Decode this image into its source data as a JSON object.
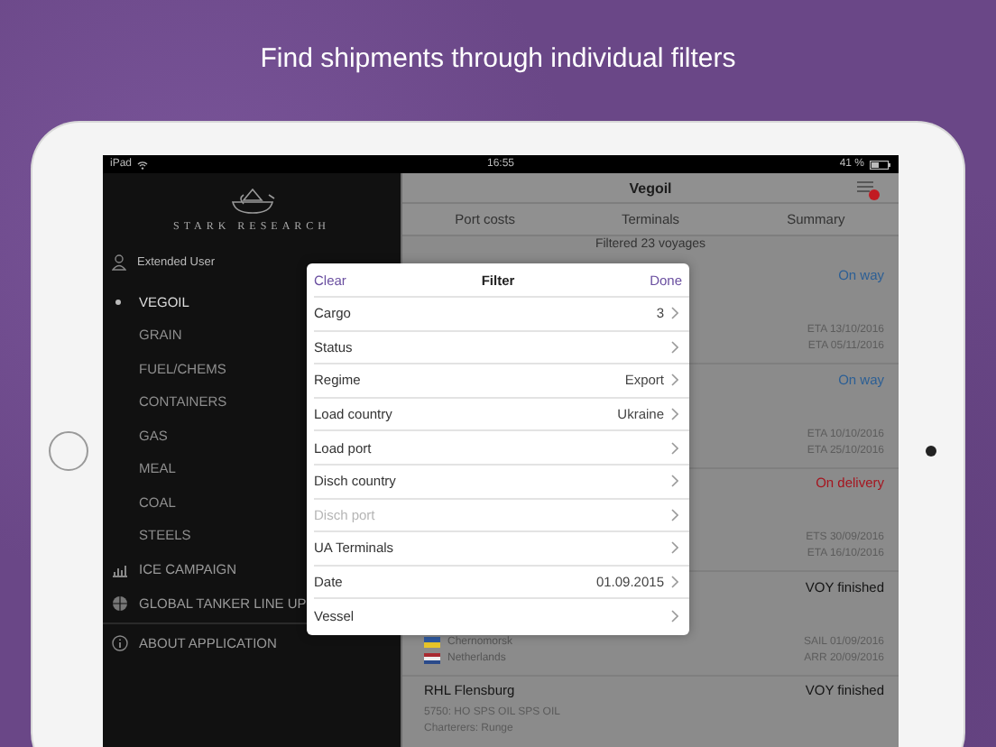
{
  "headline": "Find shipments through individual filters",
  "status_bar": {
    "carrier": "iPad",
    "time": "16:55",
    "battery": "41 %"
  },
  "sidebar": {
    "brand": "STARK RESEARCH",
    "user": "Extended User",
    "categories": [
      {
        "label": "VEGOIL",
        "selected": true
      },
      {
        "label": "GRAIN",
        "selected": false
      },
      {
        "label": "FUEL/CHEMS",
        "selected": false
      },
      {
        "label": "CONTAINERS",
        "selected": false
      },
      {
        "label": "GAS",
        "selected": false
      },
      {
        "label": "MEAL",
        "selected": false
      },
      {
        "label": "COAL",
        "selected": false
      },
      {
        "label": "STEELS",
        "selected": false
      }
    ],
    "sections": [
      {
        "label": "ICE CAMPAIGN"
      },
      {
        "label": "GLOBAL TANKER LINE UP"
      }
    ],
    "about": "ABOUT APPLICATION"
  },
  "content": {
    "title": "Vegoil",
    "tabs": [
      {
        "label": "Port costs"
      },
      {
        "label": "Terminals"
      },
      {
        "label": "Summary"
      }
    ],
    "summary": "Filtered 23 voyages",
    "voyages": [
      {
        "status": "On way",
        "color": "#2c5f95",
        "dates": [
          "ETA 13/10/2016",
          "ETA 05/11/2016"
        ]
      },
      {
        "status": "On way",
        "color": "#2c5f95",
        "dates": [
          "ETA 10/10/2016",
          "ETA 25/10/2016"
        ]
      },
      {
        "status": "On delivery",
        "color": "#a5151f",
        "dates": [
          "ETS 30/09/2016",
          "ETA 16/10/2016"
        ]
      },
      {
        "status": "VOY finished",
        "color": "#151515",
        "flags": [
          {
            "kind": "ukraine",
            "label": "Chernomorsk"
          },
          {
            "kind": "netherlands",
            "label": "Netherlands"
          }
        ],
        "dates": [
          "SAIL 01/09/2016",
          "ARR 20/09/2016"
        ]
      },
      {
        "name": "RHL Flensburg",
        "status": "VOY finished",
        "color": "#151515",
        "details": [
          "5750: HO SPS OIL SPS OIL",
          "Charterers: Runge"
        ]
      }
    ]
  },
  "filter": {
    "clear": "Clear",
    "title": "Filter",
    "done": "Done",
    "rows": [
      {
        "label": "Cargo",
        "value": "3",
        "disabled": false
      },
      {
        "label": "Status",
        "disabled": false
      },
      {
        "label": "Regime",
        "value": "Export",
        "disabled": false
      },
      {
        "label": "Load country",
        "value": "Ukraine",
        "disabled": false
      },
      {
        "label": "Load port",
        "disabled": false
      },
      {
        "label": "Disch country",
        "disabled": false
      },
      {
        "label": "Disch port",
        "disabled": true
      },
      {
        "label": "UA Terminals",
        "disabled": false
      },
      {
        "label": "Date",
        "value": "01.09.2015",
        "disabled": false
      },
      {
        "label": "Vessel",
        "disabled": false
      }
    ]
  }
}
